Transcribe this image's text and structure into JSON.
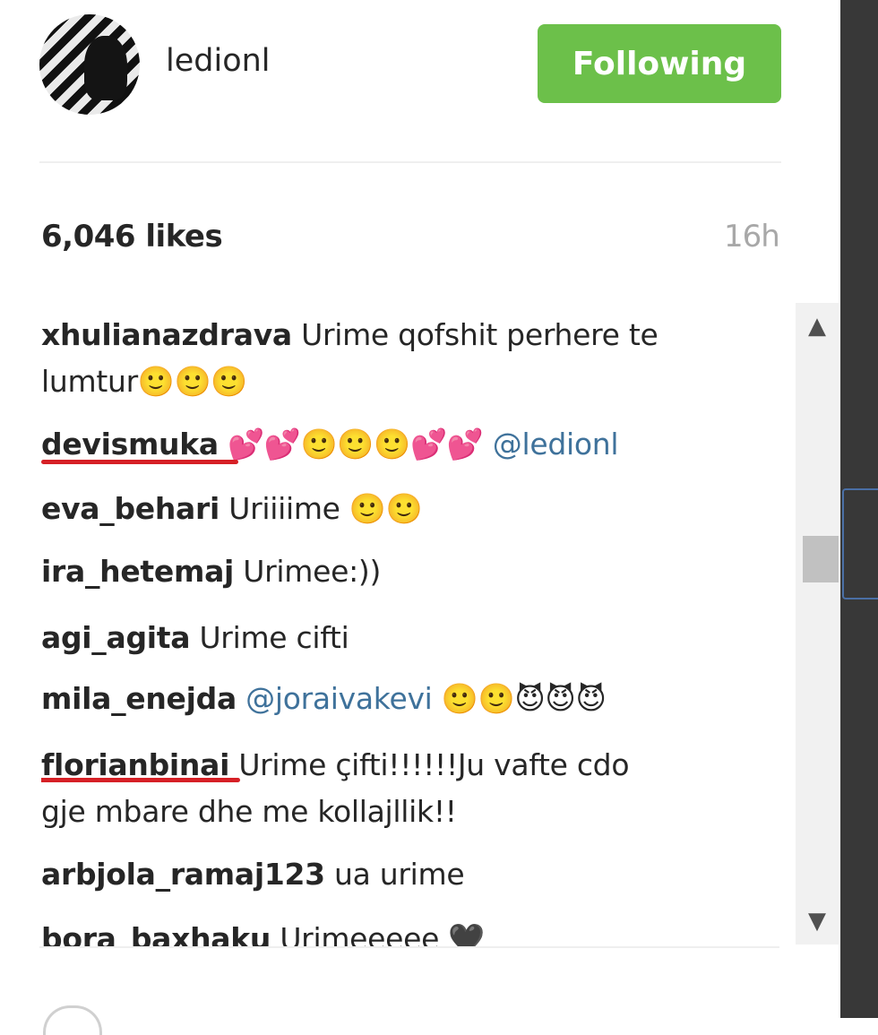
{
  "post": {
    "header": {
      "username": "ledionl",
      "follow_button_label": "Following"
    },
    "likes": "6,046 likes",
    "timestamp": "16h",
    "comments": [
      {
        "user": "xhulianazdrava",
        "text_line1": "Urime qofshit perhere te",
        "text_line2": "lumtur🙂🙂🙂"
      },
      {
        "user": "devismuka",
        "text": " 💕💕🙂🙂🙂💕💕 ",
        "mention": "@ledionl",
        "underlined": true
      },
      {
        "user": "eva_behari",
        "text": "Uriiiime 🙂🙂"
      },
      {
        "user": "ira_hetemaj",
        "text": "Urimee:))"
      },
      {
        "user": "agi_agita",
        "text": "Urime cifti"
      },
      {
        "user": "mila_enejda",
        "mention": "@joraivakevi",
        "text": " 🙂🙂😈😈😈"
      },
      {
        "user": "florianbinai",
        "text_line1": "Urime çifti!!!!!!Ju vafte cdo",
        "text_line2": "gje mbare dhe me kollajllik!!",
        "underlined": true
      },
      {
        "user": "arbjola_ramaj123",
        "text": "ua urime"
      },
      {
        "user": "bora_baxhaku",
        "text": "Urimeeeee 🖤"
      }
    ]
  },
  "colors": {
    "follow_green": "#6cc04a",
    "mention_blue": "#3f729b",
    "timestamp_gray": "#a8a8a8",
    "annotation_red": "#d62026"
  },
  "icons": {
    "scroll_up": "▲",
    "scroll_down": "▼"
  }
}
